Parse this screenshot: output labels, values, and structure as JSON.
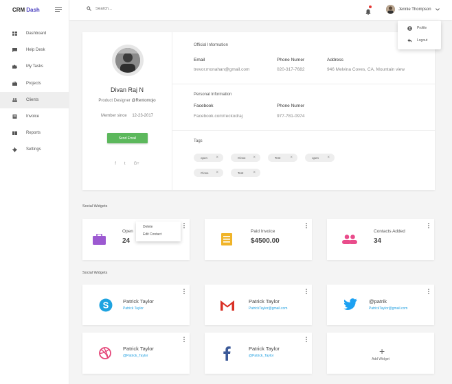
{
  "brand": {
    "part1": "CRM",
    "part2": "Dash"
  },
  "search": {
    "placeholder": "Search..."
  },
  "user": {
    "name": "Jennie Thompson"
  },
  "user_menu": [
    {
      "label": "Profile",
      "icon": "account-circle-icon"
    },
    {
      "label": "Logout",
      "icon": "reply-icon"
    }
  ],
  "sidebar": {
    "items": [
      {
        "label": "Dashboard",
        "icon": "dashboard-icon"
      },
      {
        "label": "Help Desk",
        "icon": "chat-icon"
      },
      {
        "label": "My Tasks",
        "icon": "puzzle-icon"
      },
      {
        "label": "Projects",
        "icon": "briefcase-icon"
      },
      {
        "label": "Clients",
        "icon": "people-icon",
        "active": true
      },
      {
        "label": "Invoice",
        "icon": "invoice-icon"
      },
      {
        "label": "Reports",
        "icon": "book-icon"
      },
      {
        "label": "Settings",
        "icon": "gear-icon"
      }
    ]
  },
  "profile": {
    "name": "Divan Raj N",
    "title_prefix": "Product Designer ",
    "title_company": "@Rentomojo",
    "member_label": "Member since",
    "member_date": "12-23-2017",
    "send_email": "Send Email",
    "socials": [
      "f",
      "t",
      "G+"
    ]
  },
  "official": {
    "title": "Official Information",
    "email_label": "Email",
    "email": "trevor.monahan@gmail.com",
    "phone_label": "Phone Numer",
    "phone": "020-317-7682",
    "address_label": "Address",
    "address": "946 Melvina Coves, CA, Mountain view"
  },
  "personal": {
    "title": "Personal Information",
    "facebook_label": "Facebook",
    "facebook": "Facebook.com/reckodraj",
    "phone_label": "Phone Numer",
    "phone": "977-781-0974"
  },
  "tags": {
    "title": "Tags",
    "items": [
      "open",
      "Close",
      "Test",
      "open",
      "Close",
      "Test"
    ]
  },
  "widgets_heading_1": "Social Widgets",
  "widgets_heading_2": "Social Widgets",
  "stats": [
    {
      "label": "Open Projects",
      "label_visible": "Open",
      "value": "24",
      "icon": "briefcase-icon",
      "color": "#9c59d1"
    },
    {
      "label": "Paid Invoice",
      "value": "$4500.00",
      "icon": "invoice-icon",
      "color": "#f0b429"
    },
    {
      "label": "Contacts Added",
      "value": "34",
      "icon": "people-icon",
      "color": "#e94c8b"
    }
  ],
  "context_menu": {
    "delete": "Delete",
    "edit": "Edit Contact"
  },
  "social_cards": [
    {
      "name": "Patrick Taylor",
      "sub": "Patrick Taylor",
      "icon": "skype-icon",
      "color": "#1ea3e0"
    },
    {
      "name": "Patrick Taylor",
      "sub": "PatrickTaylor@gmail.com",
      "icon": "gmail-icon",
      "color": "#d93025"
    },
    {
      "name": "@patrik",
      "sub": "PatrickTaylor@gmail.com",
      "icon": "twitter-icon",
      "color": "#1da1f2"
    },
    {
      "name": "Patrick Taylor",
      "sub": "@Patrick_Taylor",
      "icon": "dribbble-icon",
      "color": "#e5477a"
    },
    {
      "name": "Patrick Taylor",
      "sub": "@Patrick_Taylor",
      "icon": "facebook-icon",
      "color": "#3b5998"
    }
  ],
  "add_widget": {
    "label": "Add Widget",
    "symbol": "+"
  }
}
